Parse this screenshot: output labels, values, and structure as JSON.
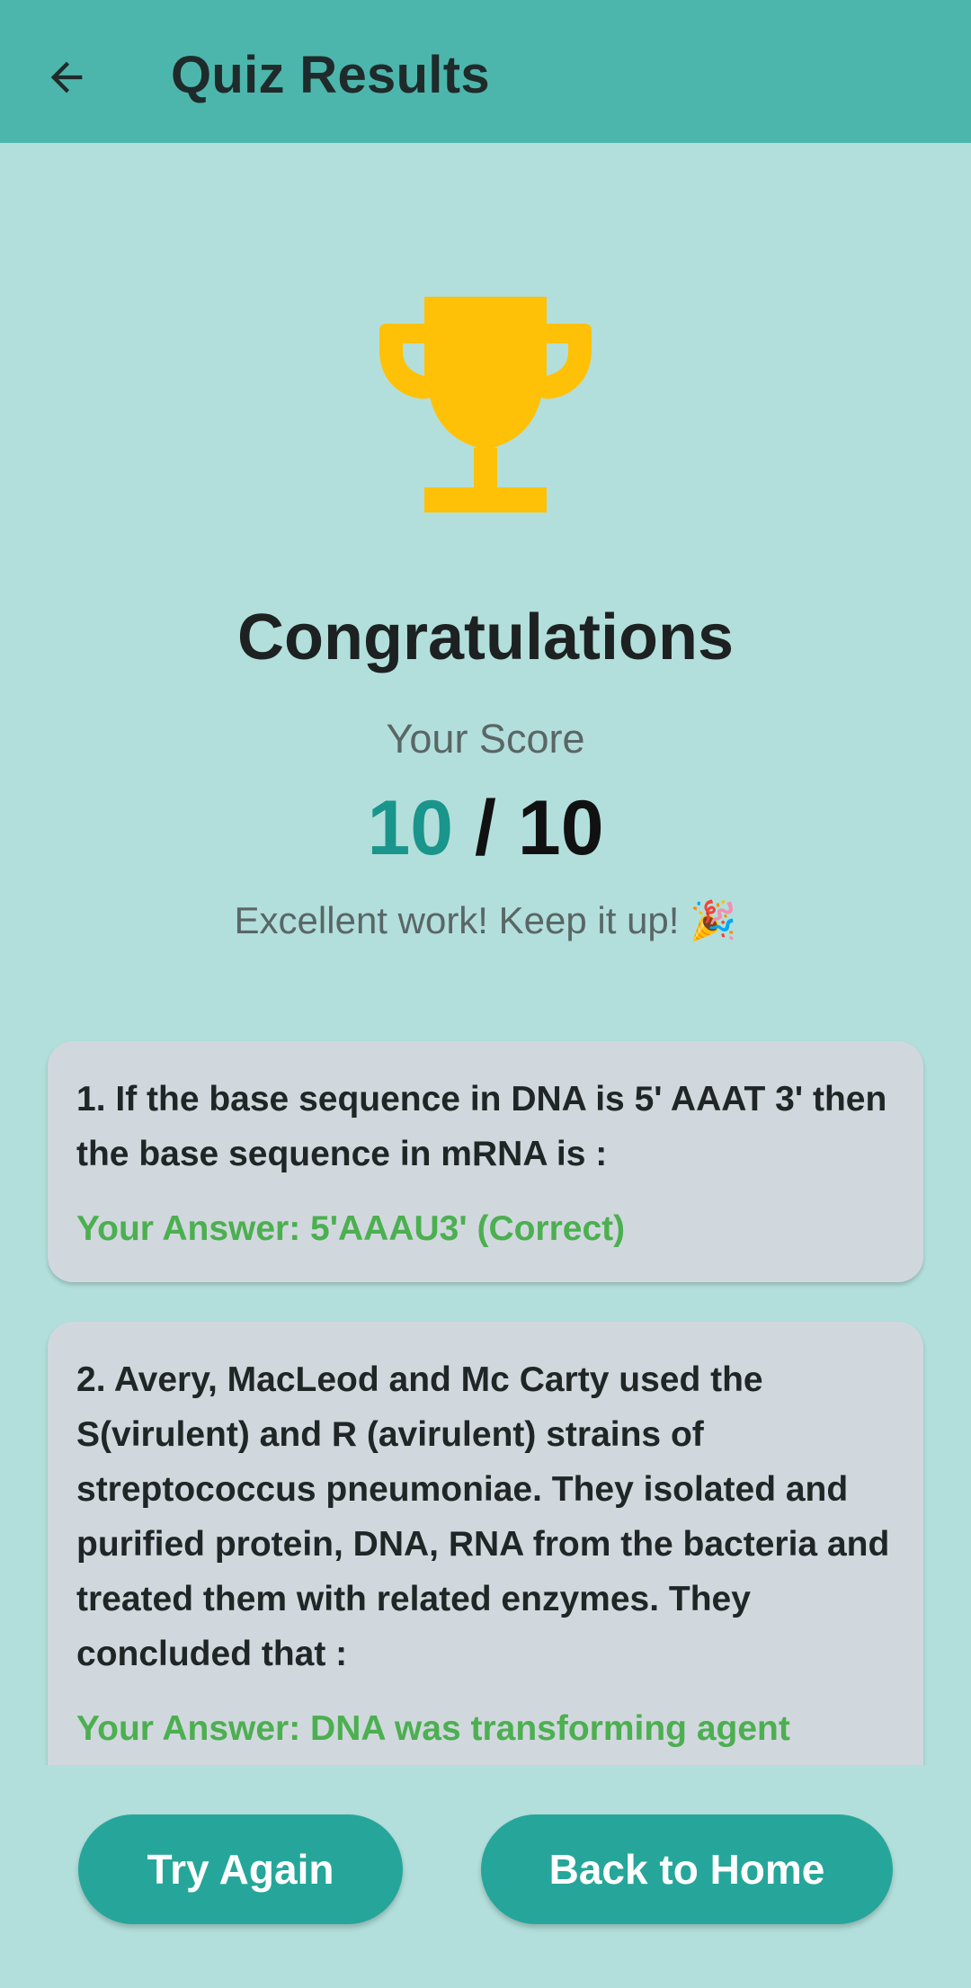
{
  "appbar": {
    "title": "Quiz Results",
    "back_icon": "arrow-left-icon"
  },
  "hero": {
    "icon": "trophy-icon",
    "trophy_color": "#ffc107",
    "heading": "Congratulations",
    "score_label": "Your Score",
    "score_value": "10",
    "score_separator": "/",
    "score_total": "10",
    "message": "Excellent work! Keep it up! 🎉"
  },
  "results": [
    {
      "question": "1. If the base sequence in DNA is 5' AAAT 3' then the base sequence in mRNA is :",
      "answer": "Your Answer: 5'AAAU3' (Correct)"
    },
    {
      "question": "2. Avery, MacLeod and Mc Carty used the S(virulent) and R (avirulent) strains of streptococcus pneumoniae. They isolated and purified protein, DNA, RNA from the bacteria and treated them with related enzymes. They concluded that :",
      "answer": "Your Answer: DNA was transforming agent (Correct)"
    }
  ],
  "buttons": {
    "try_again": "Try Again",
    "back_home": "Back to Home"
  },
  "colors": {
    "appbar": "#4db6ac",
    "background": "#b2dfdb",
    "accent": "#26a69a",
    "correct": "#4caf50",
    "card": "#d0d8dd"
  }
}
